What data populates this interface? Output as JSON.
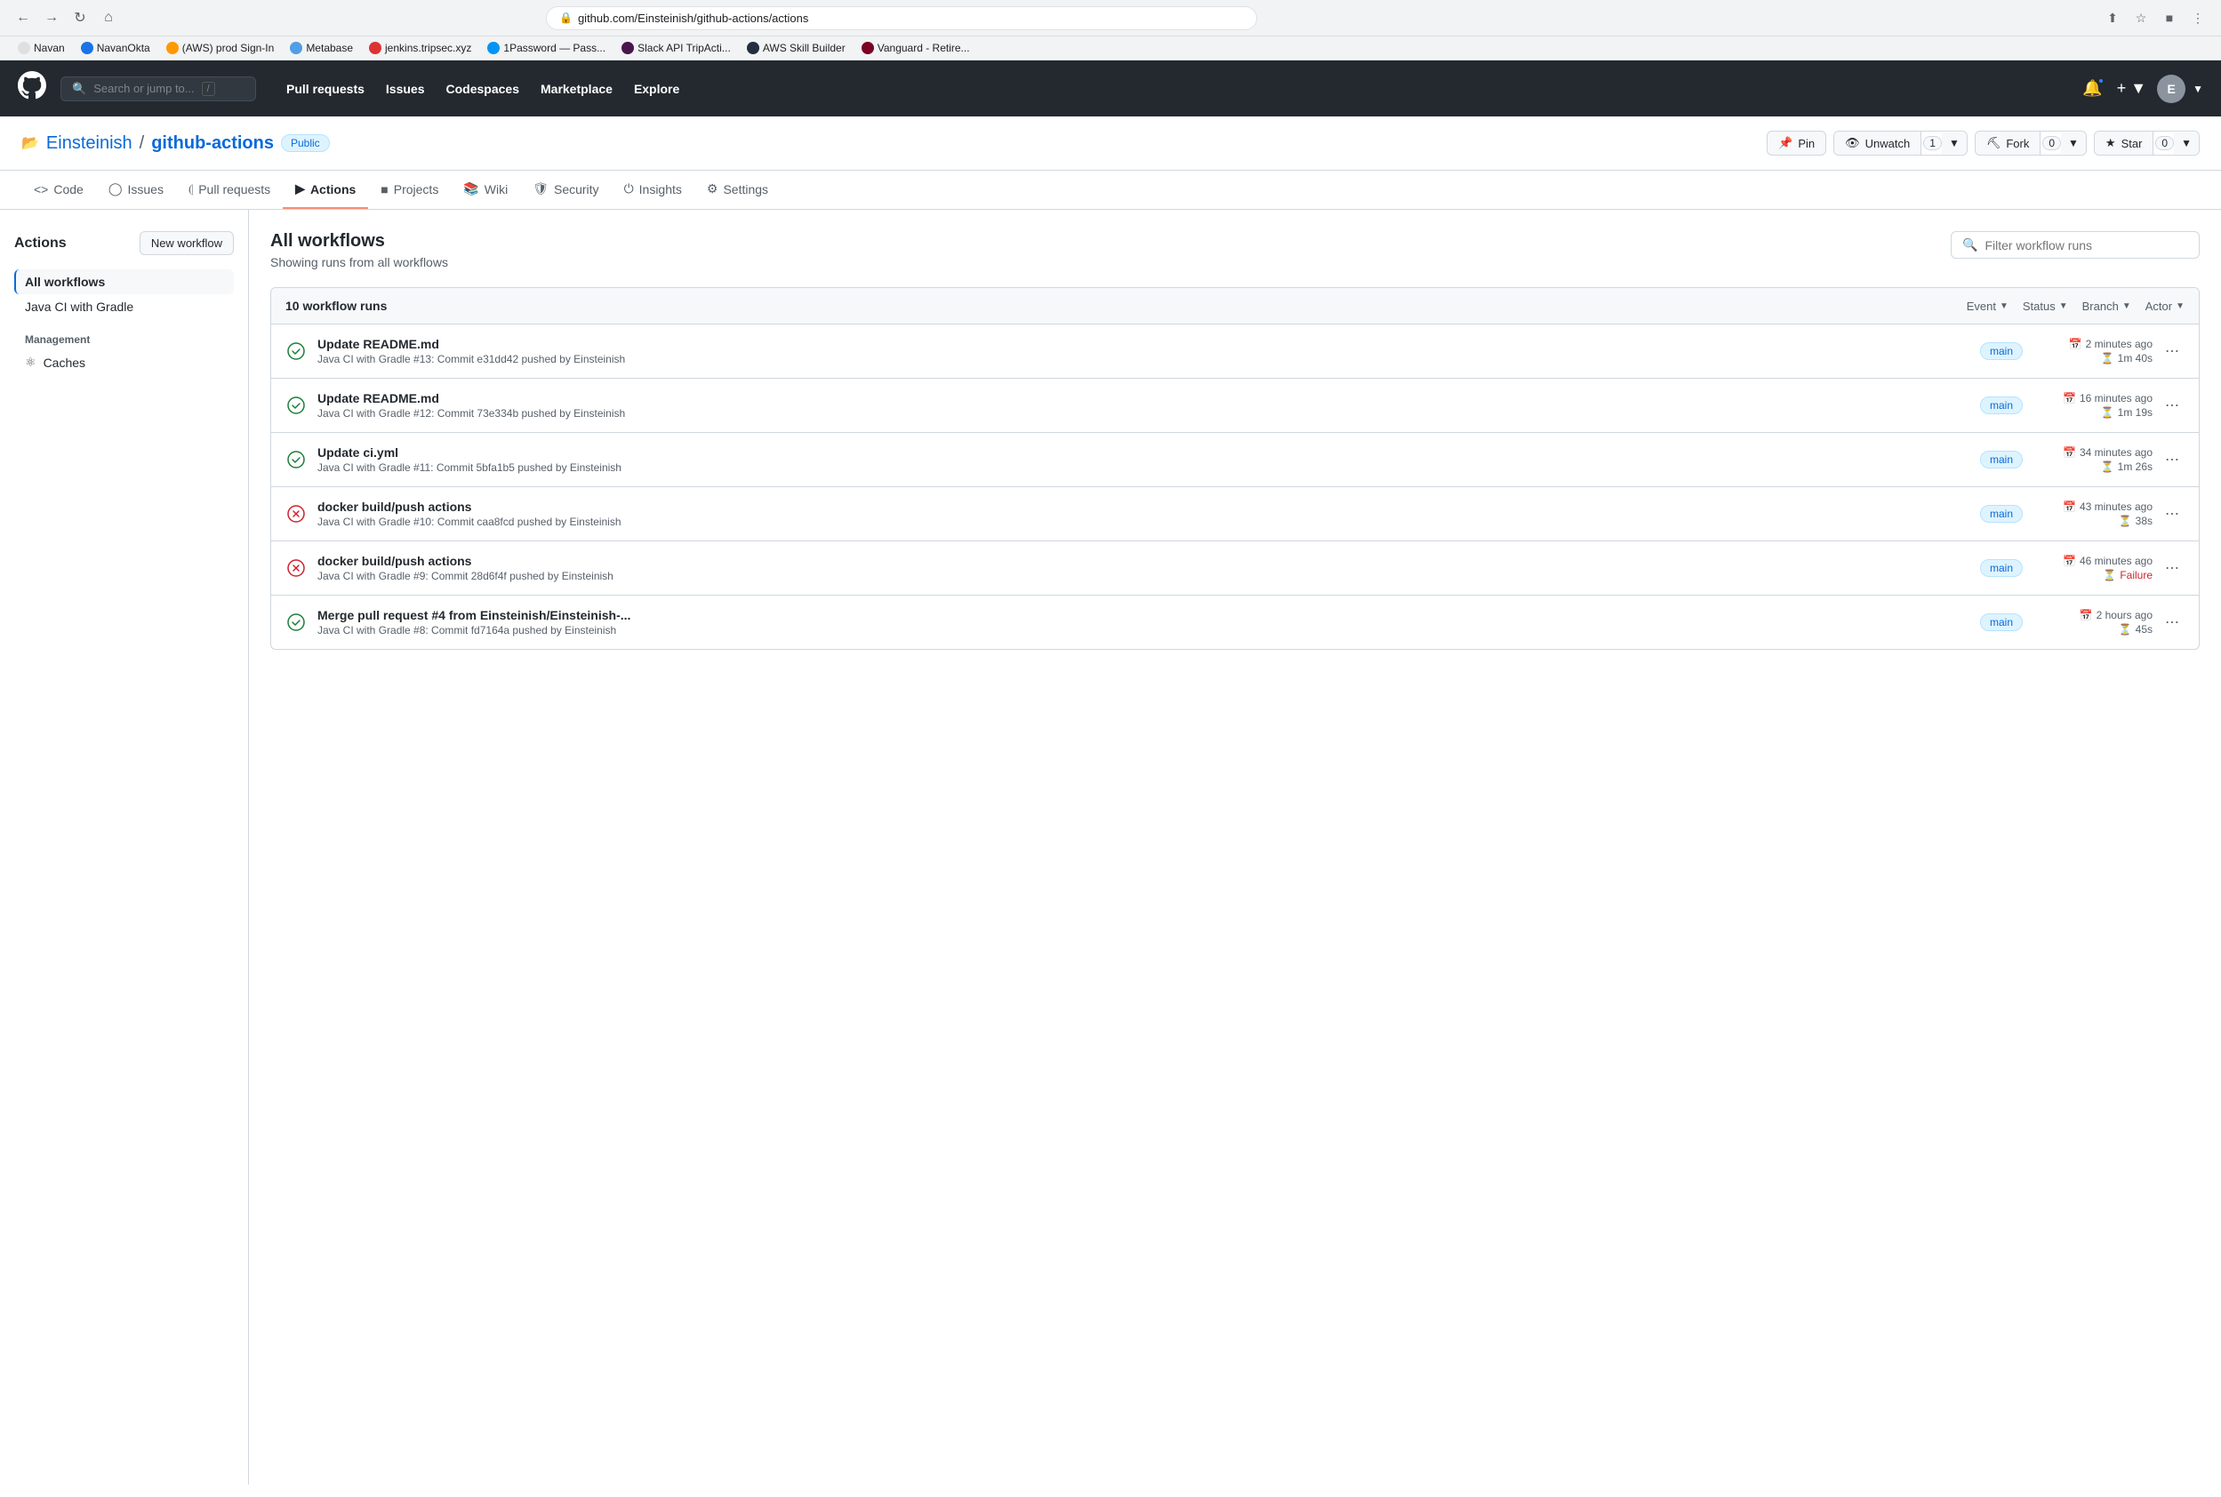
{
  "browser": {
    "url": "github.com/Einsteinish/github-actions/actions",
    "bookmarks": [
      {
        "label": "Navan",
        "color": "#e0e0e0"
      },
      {
        "label": "NavanOkta",
        "color": "#1a73e8"
      },
      {
        "label": "(AWS) prod Sign-In",
        "color": "#ff9900"
      },
      {
        "label": "Metabase",
        "color": "#509ee3"
      },
      {
        "label": "jenkins.tripsec.xyz",
        "color": "#d33"
      },
      {
        "label": "1Password — Pass...",
        "color": "#0094f5"
      },
      {
        "label": "Slack API TripActi...",
        "color": "#4a154b"
      },
      {
        "label": "AWS Skill Builder",
        "color": "#232f3e"
      },
      {
        "label": "Vanguard - Retire...",
        "color": "#7b0026"
      }
    ]
  },
  "gh_header": {
    "search_placeholder": "Search or jump to...",
    "nav_items": [
      {
        "label": "Pull requests"
      },
      {
        "label": "Issues"
      },
      {
        "label": "Codespaces"
      },
      {
        "label": "Marketplace"
      },
      {
        "label": "Explore"
      }
    ]
  },
  "repo": {
    "owner": "Einsteinish",
    "name": "github-actions",
    "visibility": "Public",
    "pin_label": "Pin",
    "unwatch_label": "Unwatch",
    "unwatch_count": "1",
    "fork_label": "Fork",
    "fork_count": "0",
    "star_label": "Star",
    "star_count": "0"
  },
  "repo_nav": {
    "tabs": [
      {
        "id": "code",
        "label": "Code",
        "icon": "<>"
      },
      {
        "id": "issues",
        "label": "Issues"
      },
      {
        "id": "pull-requests",
        "label": "Pull requests"
      },
      {
        "id": "actions",
        "label": "Actions",
        "active": true
      },
      {
        "id": "projects",
        "label": "Projects"
      },
      {
        "id": "wiki",
        "label": "Wiki"
      },
      {
        "id": "security",
        "label": "Security"
      },
      {
        "id": "insights",
        "label": "Insights"
      },
      {
        "id": "settings",
        "label": "Settings"
      }
    ]
  },
  "sidebar": {
    "title": "Actions",
    "new_workflow_label": "New workflow",
    "all_workflows_label": "All workflows",
    "workflow_items": [
      {
        "label": "Java CI with Gradle"
      }
    ],
    "management_title": "Management",
    "management_items": [
      {
        "label": "Caches",
        "icon": "⊙"
      }
    ]
  },
  "workflow_list": {
    "title": "All workflows",
    "subtitle": "Showing runs from all workflows",
    "filter_placeholder": "Filter workflow runs",
    "count_label": "10 workflow runs",
    "filters": [
      {
        "label": "Event"
      },
      {
        "label": "Status"
      },
      {
        "label": "Branch"
      },
      {
        "label": "Actor"
      }
    ],
    "runs": [
      {
        "id": 1,
        "status": "success",
        "title": "Update README.md",
        "meta": "Java CI with Gradle #13: Commit e31dd42 pushed by Einsteinish",
        "branch": "main",
        "time_ago": "2 minutes ago",
        "duration": "1m 40s",
        "duration_failure": false
      },
      {
        "id": 2,
        "status": "success",
        "title": "Update README.md",
        "meta": "Java CI with Gradle #12: Commit 73e334b pushed by Einsteinish",
        "branch": "main",
        "time_ago": "16 minutes ago",
        "duration": "1m 19s",
        "duration_failure": false
      },
      {
        "id": 3,
        "status": "success",
        "title": "Update ci.yml",
        "meta": "Java CI with Gradle #11: Commit 5bfa1b5 pushed by Einsteinish",
        "branch": "main",
        "time_ago": "34 minutes ago",
        "duration": "1m 26s",
        "duration_failure": false
      },
      {
        "id": 4,
        "status": "failure",
        "title": "docker build/push actions",
        "meta": "Java CI with Gradle #10: Commit caa8fcd pushed by Einsteinish",
        "branch": "main",
        "time_ago": "43 minutes ago",
        "duration": "38s",
        "duration_failure": false
      },
      {
        "id": 5,
        "status": "failure",
        "title": "docker build/push actions",
        "meta": "Java CI with Gradle #9: Commit 28d6f4f pushed by Einsteinish",
        "branch": "main",
        "time_ago": "46 minutes ago",
        "duration": "Failure",
        "duration_failure": true
      },
      {
        "id": 6,
        "status": "success",
        "title": "Merge pull request #4 from Einsteinish/Einsteinish-...",
        "meta": "Java CI with Gradle #8: Commit fd7164a pushed by Einsteinish",
        "branch": "main",
        "time_ago": "2 hours ago",
        "duration": "45s",
        "duration_failure": false
      }
    ]
  }
}
